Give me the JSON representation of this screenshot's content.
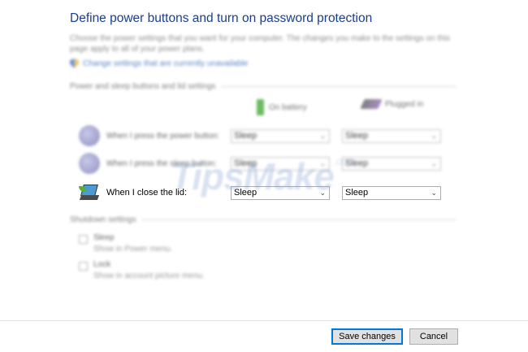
{
  "header": {
    "title": "Define power buttons and turn on password protection",
    "description": "Choose the power settings that you want for your computer. The changes you make to the settings on this page apply to all of your power plans.",
    "change_link": "Change settings that are currently unavailable"
  },
  "power_section": {
    "heading": "Power and sleep buttons and lid settings",
    "col_battery": "On battery",
    "col_plugged": "Plugged in",
    "rows": [
      {
        "label": "When I press the power button:",
        "battery": "Sleep",
        "plugged": "Sleep"
      },
      {
        "label": "When I press the sleep button:",
        "battery": "Sleep",
        "plugged": "Sleep"
      },
      {
        "label": "When I close the lid:",
        "battery": "Sleep",
        "plugged": "Sleep"
      }
    ]
  },
  "shutdown_section": {
    "heading": "Shutdown settings",
    "items": [
      {
        "label": "Sleep",
        "sub": "Show in Power menu."
      },
      {
        "label": "Lock",
        "sub": "Show in account picture menu."
      }
    ]
  },
  "watermark": {
    "text": "TipsMake",
    "suffix": ".com"
  },
  "footer": {
    "save_label": "Save changes",
    "cancel_label": "Cancel"
  },
  "colors": {
    "title": "#1a3e8c",
    "link": "#1e5fb4",
    "primary_border": "#0078d7"
  }
}
